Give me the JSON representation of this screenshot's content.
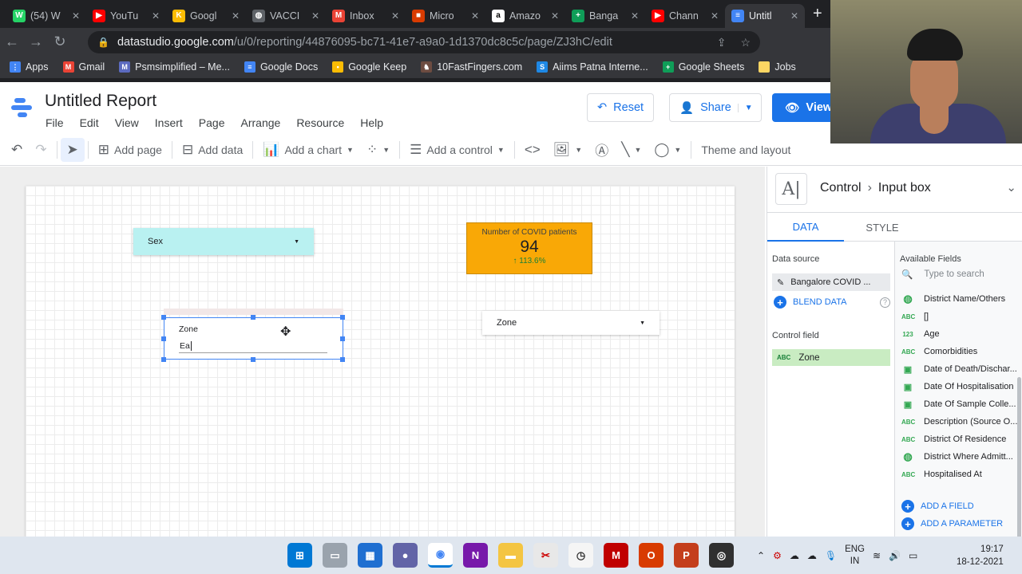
{
  "browser": {
    "tabs": [
      {
        "label": "(54) W",
        "color": "#25d366",
        "glyph": "W"
      },
      {
        "label": "YouTu",
        "color": "#ff0000",
        "glyph": "▶"
      },
      {
        "label": "Googl",
        "color": "#fbbc04",
        "glyph": "K"
      },
      {
        "label": "VACCI",
        "color": "#5f6368",
        "glyph": "◍"
      },
      {
        "label": "Inbox",
        "color": "#ea4335",
        "glyph": "M"
      },
      {
        "label": "Micro",
        "color": "#d83b01",
        "glyph": "■"
      },
      {
        "label": "Amazo",
        "color": "#ffffff",
        "glyph": "a"
      },
      {
        "label": "Banga",
        "color": "#0f9d58",
        "glyph": "+"
      },
      {
        "label": "Chann",
        "color": "#ff0000",
        "glyph": "▶"
      },
      {
        "label": "Untitl",
        "color": "#4285f4",
        "glyph": "≡"
      }
    ],
    "url_host": "datastudio.google.com",
    "url_path": "/u/0/reporting/44876095-bc71-41e7-a9a0-1d1370dc8c5c/page/ZJ3hC/edit",
    "bookmarks": [
      {
        "label": "Apps",
        "color": "#4285f4",
        "glyph": "⋮"
      },
      {
        "label": "Gmail",
        "color": "#ea4335",
        "glyph": "M"
      },
      {
        "label": "Psmsimplified – Me...",
        "color": "#5c6bc0",
        "glyph": "M"
      },
      {
        "label": "Google Docs",
        "color": "#4285f4",
        "glyph": "≡"
      },
      {
        "label": "Google Keep",
        "color": "#fbbc04",
        "glyph": "•"
      },
      {
        "label": "10FastFingers.com",
        "color": "#6d4c41",
        "glyph": "♞"
      },
      {
        "label": "Aiims Patna Interne...",
        "color": "#1e88e5",
        "glyph": "S"
      },
      {
        "label": "Google Sheets",
        "color": "#0f9d58",
        "glyph": "+"
      },
      {
        "label": "Jobs",
        "color": "#fdd663",
        "glyph": " "
      }
    ],
    "more": "»"
  },
  "app": {
    "title": "Untitled Report",
    "menus": [
      "File",
      "Edit",
      "View",
      "Insert",
      "Page",
      "Arrange",
      "Resource",
      "Help"
    ],
    "reset_label": "Reset",
    "share_label": "Share",
    "view_label": "View"
  },
  "toolbar": {
    "add_page": "Add page",
    "add_data": "Add data",
    "add_chart": "Add a chart",
    "add_control": "Add a control",
    "theme": "Theme and layout"
  },
  "canvas": {
    "sex_dropdown": "Sex",
    "zone_dropdown": "Zone",
    "scorecard_label": "Number of COVID patients",
    "scorecard_value": "94",
    "scorecard_change": "↑ 113.6%",
    "input_label": "Zone",
    "input_value": "Ea"
  },
  "panel": {
    "control_glyph": "A|",
    "crumb_parent": "Control",
    "crumb_child": "Input box",
    "tab_data": "DATA",
    "tab_style": "STYLE",
    "data_source_heading": "Data source",
    "data_source_name": "Bangalore COVID ...",
    "blend_label": "BLEND DATA",
    "control_field_heading": "Control field",
    "control_field_value": "Zone",
    "available_heading": "Available Fields",
    "search_placeholder": "Type to search",
    "fields": [
      {
        "type": "globe",
        "name": "District Name/Others"
      },
      {
        "type": "abc",
        "name": "[]"
      },
      {
        "type": "num",
        "name": "Age"
      },
      {
        "type": "abc",
        "name": "Comorbidities"
      },
      {
        "type": "cal",
        "name": "Date of Death/Dischar..."
      },
      {
        "type": "cal",
        "name": "Date Of Hospitalisation"
      },
      {
        "type": "cal",
        "name": "Date Of Sample Colle..."
      },
      {
        "type": "abc",
        "name": "Description (Source O..."
      },
      {
        "type": "abc",
        "name": "District Of Residence"
      },
      {
        "type": "globe",
        "name": "District Where Admitt..."
      },
      {
        "type": "abc",
        "name": "Hospitalised At"
      }
    ],
    "add_field": "ADD A FIELD",
    "add_param": "ADD A PARAMETER"
  },
  "taskbar": {
    "lang_top": "ENG",
    "lang_bottom": "IN",
    "time": "19:17",
    "date": "18-12-2021"
  }
}
